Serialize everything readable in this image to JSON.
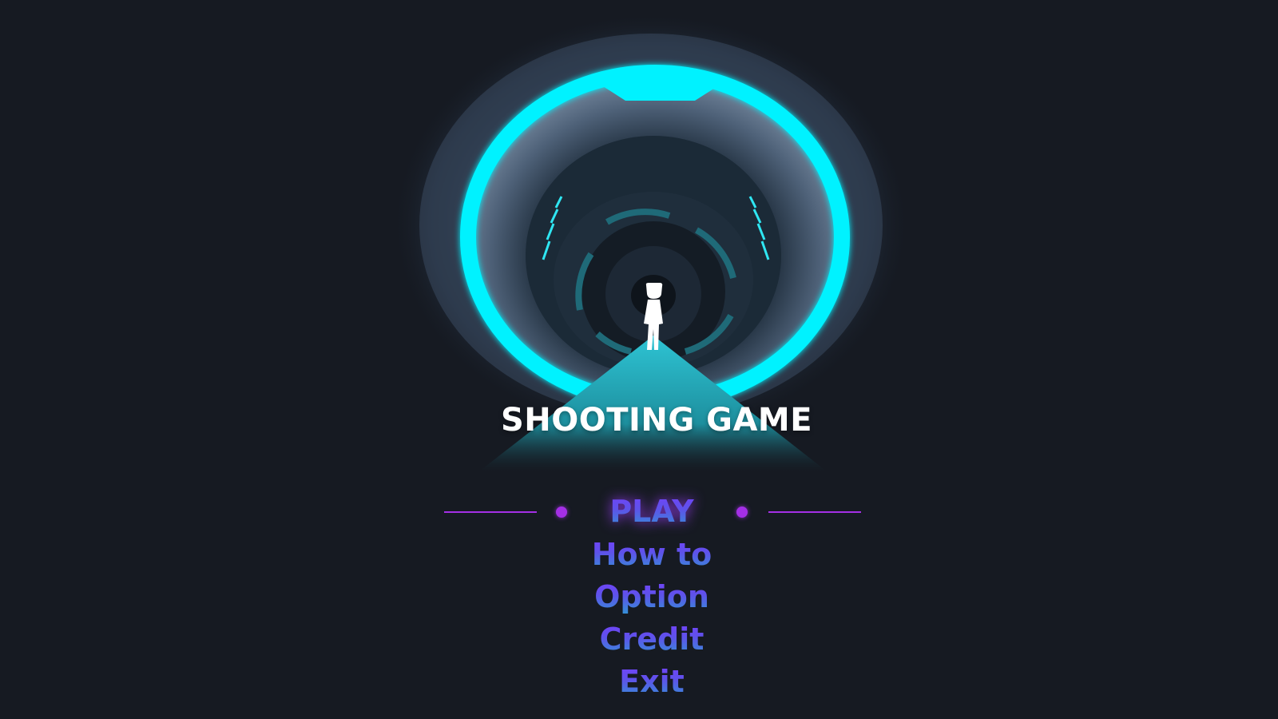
{
  "title": "SHOOTING GAME",
  "menu": {
    "items": [
      {
        "label": "PLAY",
        "selected": true
      },
      {
        "label": "How to",
        "selected": false
      },
      {
        "label": "Option",
        "selected": false
      },
      {
        "label": "Credit",
        "selected": false
      },
      {
        "label": "Exit",
        "selected": false
      }
    ]
  },
  "icons": {
    "selection_marker": "dot-line-marker",
    "player": "player-silhouette-icon"
  },
  "colors": {
    "background": "#161a22",
    "portal_ring": "#00f2ff",
    "platform": "#23b4c4",
    "selector_accent": "#a42fe6",
    "menu_gradient_top": "#7a3cff",
    "menu_gradient_bottom": "#2aa0d2",
    "title_text": "#ffffff"
  }
}
